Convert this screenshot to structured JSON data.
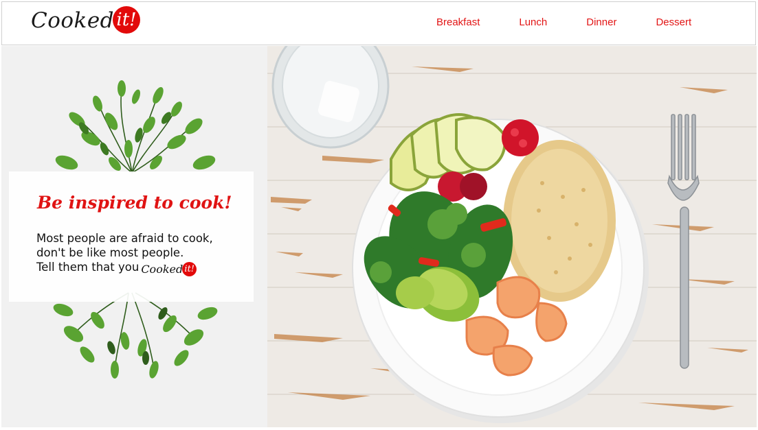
{
  "brand": {
    "name": "Cooked",
    "badge": "it!"
  },
  "nav": {
    "items": [
      {
        "label": "Breakfast"
      },
      {
        "label": "Lunch"
      },
      {
        "label": "Dinner"
      },
      {
        "label": "Dessert"
      }
    ]
  },
  "hero": {
    "heading": "Be inspired to cook!",
    "lines": [
      "Most people are afraid to cook,",
      "don't be like most people.",
      "Tell them that you"
    ],
    "inline_brand": {
      "name": "Cooked",
      "badge": "it!"
    }
  },
  "colors": {
    "accent": "#e21515",
    "badge": "#e20a0a",
    "panel_bg": "#f1f1f1",
    "table": "#ece8e3"
  },
  "icons": [
    "foliage-illustration",
    "food-plate-photo"
  ]
}
